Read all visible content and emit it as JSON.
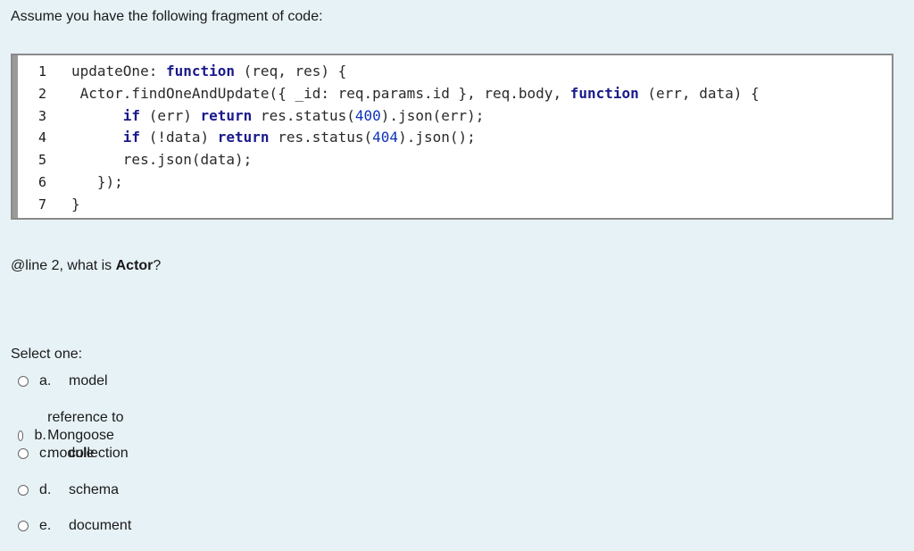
{
  "intro": "Assume you have the following fragment of code:",
  "code": {
    "line_numbers": [
      "1",
      "2",
      "3",
      "4",
      "5",
      "6",
      "7"
    ],
    "lines": [
      [
        {
          "t": "updateOne: "
        },
        {
          "t": "function",
          "k": "kw"
        },
        {
          "t": " (req, res) {"
        }
      ],
      [
        {
          "t": " Actor.findOneAndUpdate({ _id: req.params.id }, req.body, "
        },
        {
          "t": "function",
          "k": "kw"
        },
        {
          "t": " (err, data) {"
        }
      ],
      [
        {
          "t": "      "
        },
        {
          "t": "if",
          "k": "kw"
        },
        {
          "t": " (err) "
        },
        {
          "t": "return",
          "k": "kw"
        },
        {
          "t": " res.status("
        },
        {
          "t": "400",
          "k": "num"
        },
        {
          "t": ").json(err);"
        }
      ],
      [
        {
          "t": "      "
        },
        {
          "t": "if",
          "k": "kw"
        },
        {
          "t": " (!data) "
        },
        {
          "t": "return",
          "k": "kw"
        },
        {
          "t": " res.status("
        },
        {
          "t": "404",
          "k": "num"
        },
        {
          "t": ").json();"
        }
      ],
      [
        {
          "t": "      res.json(data);"
        }
      ],
      [
        {
          "t": "   });"
        }
      ],
      [
        {
          "t": "}"
        }
      ]
    ]
  },
  "question": {
    "prefix": "@line 2, what is ",
    "bold": "Actor",
    "suffix": "?"
  },
  "select_label": "Select one:",
  "options": [
    {
      "letter": "a.",
      "text": "model"
    },
    {
      "letter": "b.",
      "text": "reference to Mongoose module"
    },
    {
      "letter": "c.",
      "text": "collection"
    },
    {
      "letter": "d.",
      "text": "schema"
    },
    {
      "letter": "e.",
      "text": "document"
    }
  ]
}
